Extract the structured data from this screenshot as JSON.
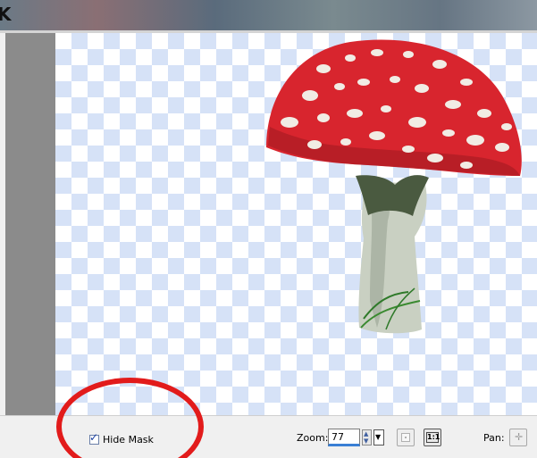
{
  "status_bar": {
    "hide_mask_label": "Hide Mask",
    "hide_mask_checked": true,
    "zoom_label": "Zoom:",
    "zoom_value": "77",
    "one_to_one_label": "1:1",
    "pan_label": "Pan:"
  },
  "icons": {
    "spin": "up-down-arrows-icon",
    "dropdown": "chevron-down-icon",
    "fit": "fit-to-window-icon",
    "pan": "pan-cross-icon"
  },
  "colors": {
    "annotation": "#e21b1b",
    "checker": "#d6e2f7",
    "mushroom_cap": "#d8252e",
    "panel": "#8b8b8b"
  }
}
